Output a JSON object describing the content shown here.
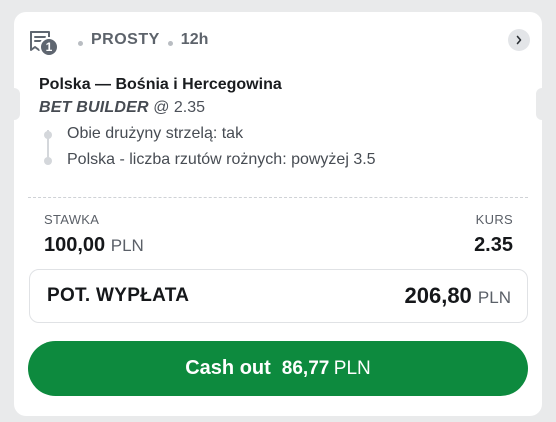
{
  "header": {
    "selection_count": "1",
    "bet_type": "PROSTY",
    "time_ago": "12h"
  },
  "match": {
    "title": "Polska — Bośnia i Hercegowina",
    "builder_tag": "BET BUILDER",
    "builder_odds": "@ 2.35",
    "selections": [
      "Obie drużyny strzelą: tak",
      "Polska - liczba rzutów rożnych: powyżej 3.5"
    ]
  },
  "stake": {
    "label": "STAWKA",
    "amount": "100,00",
    "currency": "PLN"
  },
  "odds": {
    "label": "KURS",
    "value": "2.35"
  },
  "payout": {
    "label": "POT. WYPŁATA",
    "amount": "206,80",
    "currency": "PLN"
  },
  "cashout": {
    "label": "Cash out",
    "amount": "86,77",
    "currency": "PLN"
  },
  "colors": {
    "cashout_green": "#0d8a3e",
    "badge_gray": "#5f6670"
  },
  "icons": {
    "ticket": "ticket-icon",
    "chevron": "chevron-right-icon"
  }
}
